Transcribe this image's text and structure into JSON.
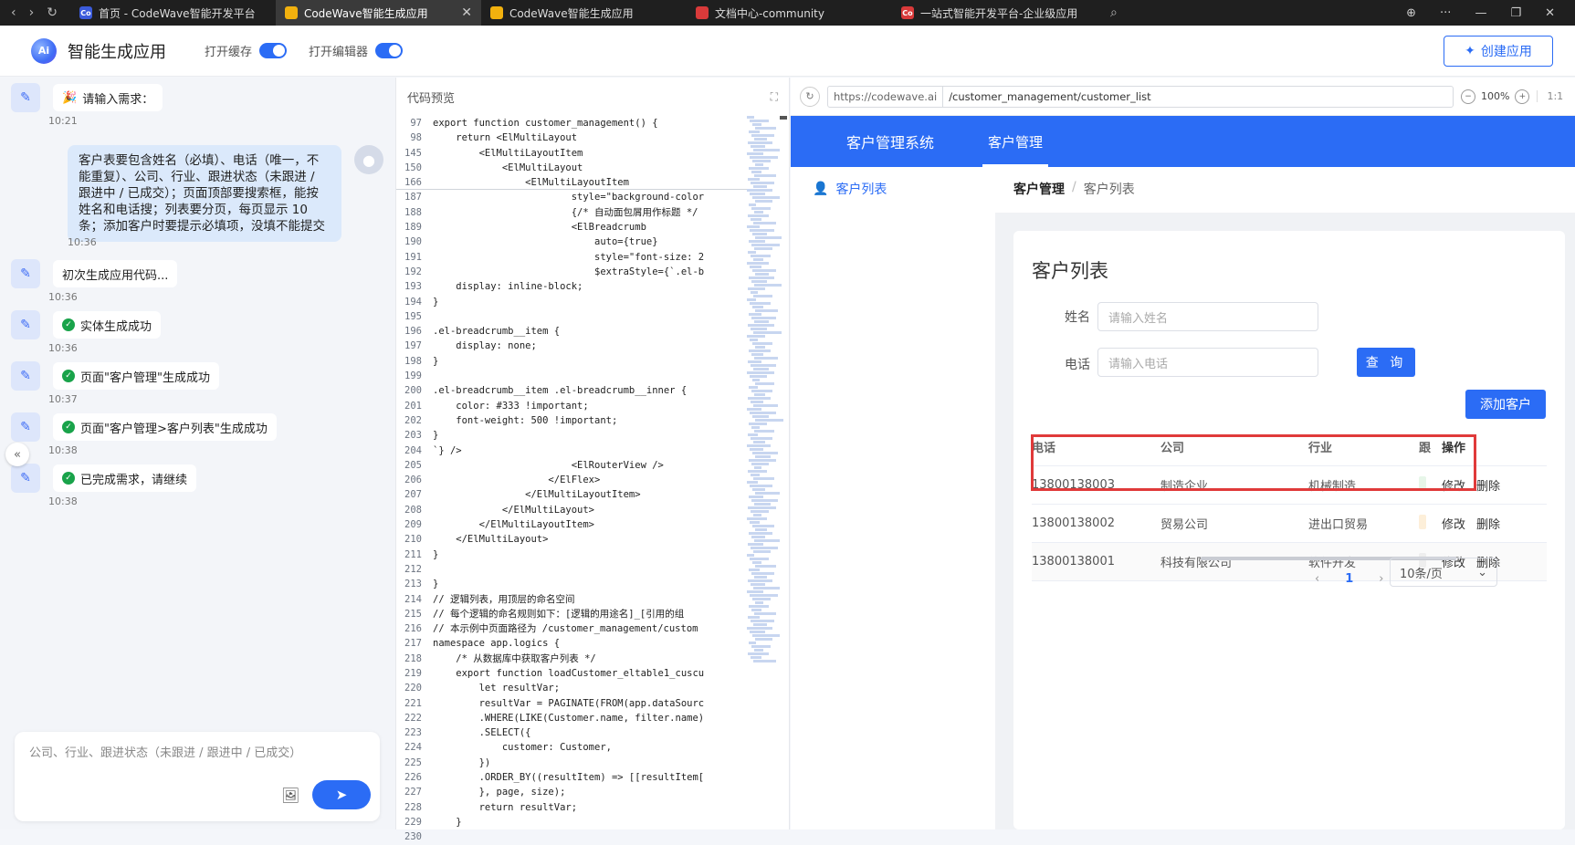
{
  "browser": {
    "tabs": [
      {
        "title": "首页 - CodeWave智能开发平台",
        "fav": "Co",
        "fav_color": "#3b5bdb",
        "active": false
      },
      {
        "title": "CodeWave智能生成应用",
        "fav": "",
        "fav_color": "#f2b10e",
        "active": true
      },
      {
        "title": "CodeWave智能生成应用",
        "fav": "",
        "fav_color": "#f2b10e",
        "active": false
      },
      {
        "title": "文档中心-community",
        "fav": "",
        "fav_color": "#d93a3a",
        "active": false
      },
      {
        "title": "一站式智能开发平台-企业级应用",
        "fav": "Co",
        "fav_color": "#d93a3a",
        "active": false
      }
    ]
  },
  "header": {
    "logo_text": "Ai",
    "title": "智能生成应用",
    "toggle_cache_label": "打开缓存",
    "toggle_editor_label": "打开编辑器",
    "create_button": "创建应用"
  },
  "chat": {
    "messages": [
      {
        "text": "请输入需求：",
        "time": "10:21"
      },
      {
        "text": "初次生成应用代码...",
        "time": "10:36"
      },
      {
        "text": "实体生成成功",
        "time": "10:36"
      },
      {
        "text": "页面\"客户管理\"生成成功",
        "time": "10:37"
      },
      {
        "text": "页面\"客户管理>客户列表\"生成成功",
        "time": "10:38"
      },
      {
        "text": "已完成需求，请继续",
        "time": "10:38"
      }
    ],
    "user_message": "客户表要包含姓名（必填）、电话（唯一，不能重复）、公司、行业、跟进状态（未跟进 / 跟进中 / 已成交）；页面顶部要搜索框，能按姓名和电话搜；列表要分页，每页显示 10 条；添加客户时要提示必填项，没填不能提交",
    "user_time": "10:36",
    "input_placeholder": "公司、行业、跟进状态（未跟进 / 跟进中 / 已成交）"
  },
  "code": {
    "title": "代码预览",
    "lines": [
      {
        "n": "97",
        "t": "export function customer_management() {"
      },
      {
        "n": "98",
        "t": "    return <ElMultiLayout"
      },
      {
        "n": "145",
        "t": "        <ElMultiLayoutItem"
      },
      {
        "n": "150",
        "t": "            <ElMultiLayout"
      },
      {
        "n": "166",
        "t": "                <ElMultiLayoutItem"
      },
      {
        "n": "187",
        "t": "                        style=\"background-color"
      },
      {
        "n": "188",
        "t": "                        {/* 自动面包屑用作标题 */"
      },
      {
        "n": "189",
        "t": "                        <ElBreadcrumb"
      },
      {
        "n": "190",
        "t": "                            auto={true}"
      },
      {
        "n": "191",
        "t": "                            style=\"font-size: 2"
      },
      {
        "n": "192",
        "t": "                            $extraStyle={`.el-b"
      },
      {
        "n": "193",
        "t": "    display: inline-block;"
      },
      {
        "n": "194",
        "t": "}"
      },
      {
        "n": "195",
        "t": ""
      },
      {
        "n": "196",
        "t": ".el-breadcrumb__item {"
      },
      {
        "n": "197",
        "t": "    display: none;"
      },
      {
        "n": "198",
        "t": "}"
      },
      {
        "n": "199",
        "t": ""
      },
      {
        "n": "200",
        "t": ".el-breadcrumb__item .el-breadcrumb__inner {"
      },
      {
        "n": "201",
        "t": "    color: #333 !important;"
      },
      {
        "n": "202",
        "t": "    font-weight: 500 !important;"
      },
      {
        "n": "203",
        "t": "}"
      },
      {
        "n": "204",
        "t": "`} />"
      },
      {
        "n": "205",
        "t": "                        <ElRouterView />"
      },
      {
        "n": "206",
        "t": "                    </ElFlex>"
      },
      {
        "n": "207",
        "t": "                </ElMultiLayoutItem>"
      },
      {
        "n": "208",
        "t": "            </ElMultiLayout>"
      },
      {
        "n": "209",
        "t": "        </ElMultiLayoutItem>"
      },
      {
        "n": "210",
        "t": "    </ElMultiLayout>"
      },
      {
        "n": "211",
        "t": "}"
      },
      {
        "n": "212",
        "t": ""
      },
      {
        "n": "213",
        "t": "}"
      },
      {
        "n": "214",
        "t": "// 逻辑列表，用顶层的命名空间"
      },
      {
        "n": "215",
        "t": "// 每个逻辑的命名规则如下：[逻辑的用途名]_[引用的组"
      },
      {
        "n": "216",
        "t": "// 本示例中页面路径为 /customer_management/custom"
      },
      {
        "n": "217",
        "t": "namespace app.logics {"
      },
      {
        "n": "218",
        "t": "    /* 从数据库中获取客户列表 */"
      },
      {
        "n": "219",
        "t": "    export function loadCustomer_eltable1_cuscu"
      },
      {
        "n": "220",
        "t": "        let resultVar;"
      },
      {
        "n": "221",
        "t": "        resultVar = PAGINATE(FROM(app.dataSourc"
      },
      {
        "n": "222",
        "t": "        .WHERE(LIKE(Customer.name, filter.name)"
      },
      {
        "n": "223",
        "t": "        .SELECT({"
      },
      {
        "n": "224",
        "t": "            customer: Customer,"
      },
      {
        "n": "225",
        "t": "        })"
      },
      {
        "n": "226",
        "t": "        .ORDER_BY((resultItem) => [[resultItem["
      },
      {
        "n": "227",
        "t": "        }, page, size);"
      },
      {
        "n": "228",
        "t": "        return resultVar;"
      },
      {
        "n": "229",
        "t": "    }"
      },
      {
        "n": "230",
        "t": ""
      }
    ]
  },
  "preview": {
    "url_host": "https://codewave.ai",
    "url_path": "/customer_management/customer_list",
    "zoom": "100%",
    "ratio": "1:1",
    "site_brand": "客户管理系统",
    "site_tab": "客户管理",
    "side_item": "客户列表",
    "breadcrumb": [
      "客户管理",
      "客户列表"
    ],
    "card_title": "客户列表",
    "name_label": "姓名",
    "name_placeholder": "请输入姓名",
    "phone_label": "电话",
    "phone_placeholder": "请输入电话",
    "query_button": "查 询",
    "add_button": "添加客户",
    "table": {
      "headers": [
        "电话",
        "公司",
        "行业",
        "跟",
        "操作"
      ],
      "rows": [
        {
          "phone": "13800138003",
          "company": "制造企业",
          "industry": "机械制造",
          "tag_color": "#e7f6e9"
        },
        {
          "phone": "13800138002",
          "company": "贸易公司",
          "industry": "进出口贸易",
          "tag_color": "#fdefd9"
        },
        {
          "phone": "13800138001",
          "company": "科技有限公司",
          "industry": "软件开发",
          "tag_color": "#eeeeee"
        }
      ],
      "edit_label": "修改",
      "delete_label": "删除"
    },
    "pager": {
      "prev": "‹",
      "current": "1",
      "next": "›",
      "page_size": "10条/页"
    }
  }
}
